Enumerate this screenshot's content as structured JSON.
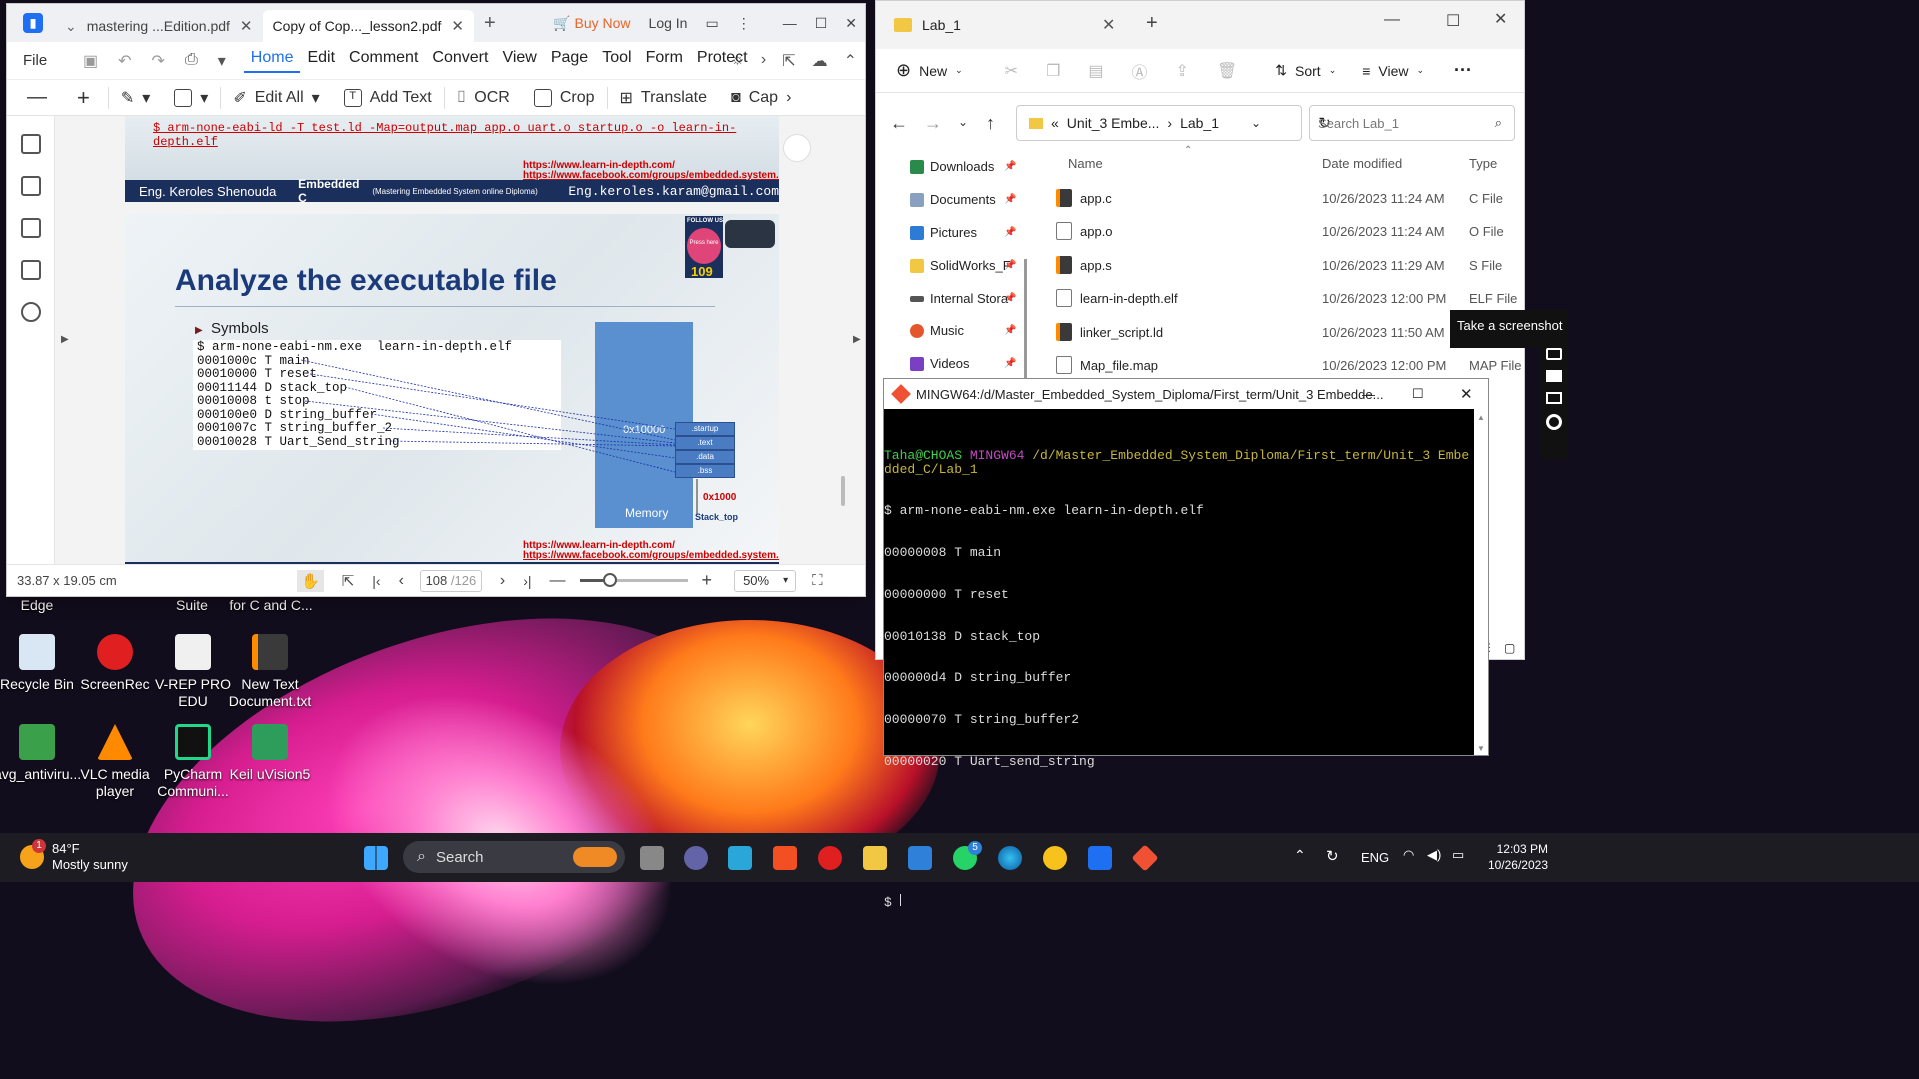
{
  "pdf": {
    "tabs": [
      {
        "label": "mastering ...Edition.pdf"
      },
      {
        "label": "Copy of Cop..._lesson2.pdf"
      }
    ],
    "buy_now": "Buy Now",
    "login": "Log In",
    "file_menu": "File",
    "menu": [
      "Home",
      "Edit",
      "Comment",
      "Convert",
      "View",
      "Page",
      "Tool",
      "Form",
      "Protect"
    ],
    "toolbar": {
      "edit_all": "Edit All",
      "add_text": "Add Text",
      "ocr": "OCR",
      "crop": "Crop",
      "translate": "Translate",
      "capture": "Cap"
    },
    "page1": {
      "command": "$ arm-none-eabi-ld -T test.ld -Map=output.map app.o uart.o startup.o -o learn-in-depth.elf",
      "link1": "https://www.learn-in-depth.com/",
      "link2": "https://www.facebook.com/groups/embedded.system.KS/",
      "footer_author": "Eng. Keroles Shenouda",
      "footer_course": "Embedded C",
      "footer_course_sub": "(Mastering Embedded System online Diploma)",
      "footer_email": "Eng.keroles.karam@gmail.com"
    },
    "page2": {
      "title": "Analyze the executable file",
      "bullet": "Symbols",
      "code": [
        "$ arm-none-eabi-nm.exe  learn-in-depth.elf",
        "0001000c T main",
        "00010000 T reset",
        "00011144 D stack_top",
        "00010008 t stop",
        "000100e0 D string_buffer",
        "0001007c T string_buffer_2",
        "00010028 T Uart_Send_string"
      ],
      "mem_addr": "0x10000",
      "mem_label": "Memory",
      "sections": [
        ".startup",
        ".text",
        ".data",
        ".bss"
      ],
      "addr2": "0x1000",
      "stack": "Stack_top",
      "follow_us": "FOLLOW US",
      "press_here": "Press here",
      "page_badge": "109",
      "link1": "https://www.learn-in-depth.com/",
      "link2": "https://www.facebook.com/groups/embedded.system.KS/"
    },
    "status": {
      "size": "33.87 x 19.05 cm",
      "page": "108",
      "total": "/126",
      "zoom": "50%",
      "zoom_level": 0.28
    }
  },
  "explorer": {
    "tab": "Lab_1",
    "new": "New",
    "sort": "Sort",
    "view": "View",
    "breadcrumb": [
      "Unit_3 Embe...",
      "Lab_1"
    ],
    "search_placeholder": "Search Lab_1",
    "nav": [
      "Downloads",
      "Documents",
      "Pictures",
      "SolidWorks_F",
      "Internal Stora",
      "Music",
      "Videos"
    ],
    "columns": {
      "name": "Name",
      "date": "Date modified",
      "type": "Type"
    },
    "files": [
      {
        "name": "app.c",
        "date": "10/26/2023 11:24 AM",
        "type": "C File"
      },
      {
        "name": "app.o",
        "date": "10/26/2023 11:24 AM",
        "type": "O File"
      },
      {
        "name": "app.s",
        "date": "10/26/2023 11:29 AM",
        "type": "S File"
      },
      {
        "name": "learn-in-depth.elf",
        "date": "10/26/2023 12:00 PM",
        "type": "ELF File"
      },
      {
        "name": "linker_script.ld",
        "date": "10/26/2023 11:50 AM",
        "type": "LD File"
      },
      {
        "name": "Map_file.map",
        "date": "10/26/2023 12:00 PM",
        "type": "MAP File"
      }
    ]
  },
  "terminal": {
    "title": "MINGW64:/d/Master_Embedded_System_Diploma/First_term/Unit_3 Embedde...",
    "user": "Taha@CHOAS",
    "shell": "MINGW64",
    "path": "/d/Master_Embedded_System_Diploma/First_term/Unit_3 Embedded_C/Lab_1",
    "command": "$ arm-none-eabi-nm.exe learn-in-depth.elf",
    "output": [
      "00000008 T main",
      "00000000 T reset",
      "00010138 D stack_top",
      "000000d4 D string_buffer",
      "00000070 T string_buffer2",
      "00000020 T Uart_send_string"
    ],
    "prompt": "$"
  },
  "screenshot_tip": "Take a screenshot",
  "desktop": {
    "top_labels": [
      "Edge",
      "Suite",
      "for C and C..."
    ],
    "icons": [
      {
        "label": "Recycle Bin",
        "color": "#d9e7f5"
      },
      {
        "label": "ScreenRec",
        "color": "#e02020"
      },
      {
        "label": "V-REP PRO EDU",
        "color": "#f0f0f0"
      },
      {
        "label": "New Text Document.txt",
        "color": "#ff8a00"
      },
      {
        "label": "avg_antiviru...",
        "color": "#3aa14a"
      },
      {
        "label": "VLC media player",
        "color": "#ff8a00"
      },
      {
        "label": "PyCharm Communi...",
        "color": "#21d789"
      },
      {
        "label": "Keil uVision5",
        "color": "#2e9c5a"
      }
    ]
  },
  "taskbar": {
    "weather_temp": "84°F",
    "weather_desc": "Mostly sunny",
    "weather_badge": "1",
    "search": "Search",
    "lang": "ENG",
    "time": "12:03 PM",
    "date": "10/26/2023",
    "whatsapp_badge": "5"
  }
}
